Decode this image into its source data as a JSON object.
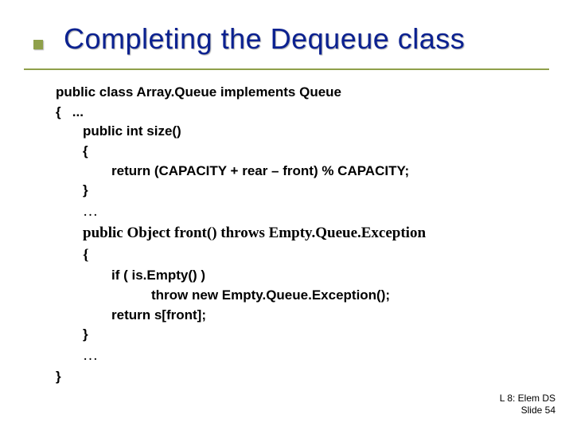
{
  "title": "Completing the Dequeue class",
  "code": {
    "l1": "public class Array.Queue implements Queue",
    "l2a": "{",
    "l2b": "...",
    "l3": "public int size()",
    "l4": "{",
    "l5": "return (CAPACITY + rear – front) % CAPACITY;",
    "l6": "}",
    "l7": "…",
    "l8": "public Object front() throws Empty.Queue.Exception",
    "l9": "{",
    "l10": "if ( is.Empty() )",
    "l11": "throw new Empty.Queue.Exception();",
    "l12": "return s[front];",
    "l13": "}",
    "l14": "…",
    "l15": "}"
  },
  "footer": {
    "line1": "L 8: Elem DS",
    "line2": "Slide 54"
  }
}
